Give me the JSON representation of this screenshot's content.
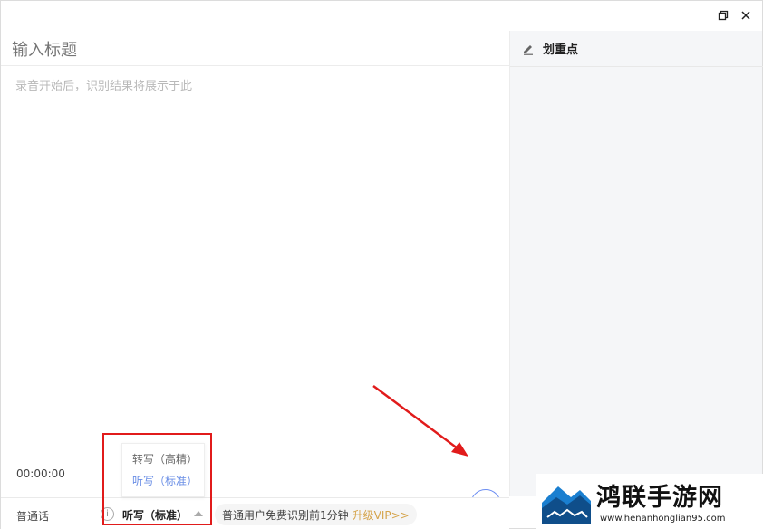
{
  "window": {
    "restore_icon": "restore-icon",
    "close_icon": "close-icon"
  },
  "editor": {
    "title_placeholder": "输入标题",
    "content_placeholder": "录音开始后，识别结果将展示于此",
    "timer": "00:00:00"
  },
  "side_panel": {
    "icon": "pen-icon",
    "title": "划重点"
  },
  "bottom_bar": {
    "language": "普通话",
    "mode_selected": "听写（标准）",
    "notice": "普通用户免费识别前1分钟",
    "vip_link": "升级VIP>>"
  },
  "mode_dropdown": {
    "options": [
      "转写（高精）",
      "听写（标准）"
    ]
  },
  "annotation": {
    "box_color": "#e11b1b",
    "arrow_color": "#e11b1b"
  },
  "colors": {
    "accent": "#5d86f4",
    "vip": "#d5a44b"
  },
  "watermark": {
    "text": "鸿联手游网",
    "url": "www.henanhonglian95.com"
  }
}
